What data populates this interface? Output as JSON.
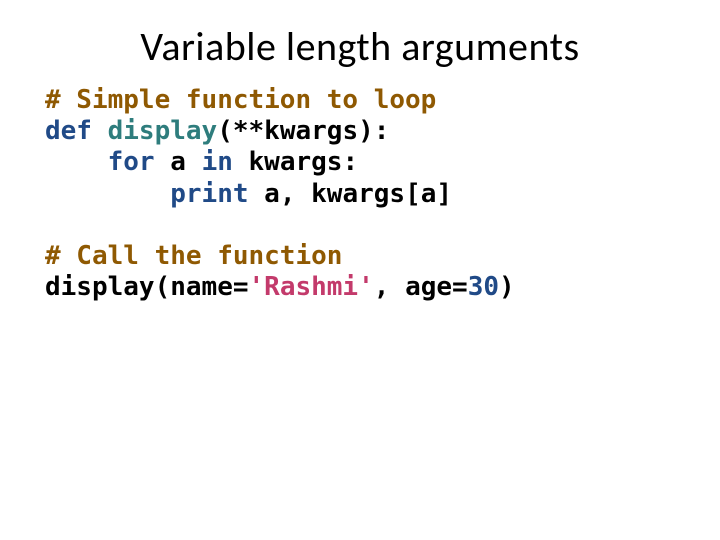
{
  "title": "Variable length arguments",
  "code": {
    "l1_hash": "#",
    "l1_rest": " Simple function to loop",
    "l2_def": "def",
    "l2_sp1": " ",
    "l2_func": "display",
    "l2_open": "(**",
    "l2_kwargs": "kwargs",
    "l2_close": "):",
    "l3_indent": "    ",
    "l3_for": "for",
    "l3_sp1": " ",
    "l3_a": "a",
    "l3_sp2": " ",
    "l3_in": "in",
    "l3_sp3": " ",
    "l3_kwargs": "kwargs",
    "l3_colon": ":",
    "l4_indent": "        ",
    "l4_print": "print",
    "l4_sp1": " ",
    "l4_a": "a",
    "l4_comma": ",",
    "l4_sp2": " ",
    "l4_kwargs": "kwargs",
    "l4_lbrack": "[",
    "l4_idx": "a",
    "l4_rbrack": "]",
    "l5_blank": "",
    "l6_hash": "#",
    "l6_rest": " Call the function",
    "l7_call": "display",
    "l7_open": "(",
    "l7_name_k": "name",
    "l7_eq1": "=",
    "l7_name_v": "'Rashmi'",
    "l7_comma": ",",
    "l7_sp": " ",
    "l7_age_k": "age",
    "l7_eq2": "=",
    "l7_age_v": "30",
    "l7_close": ")"
  }
}
